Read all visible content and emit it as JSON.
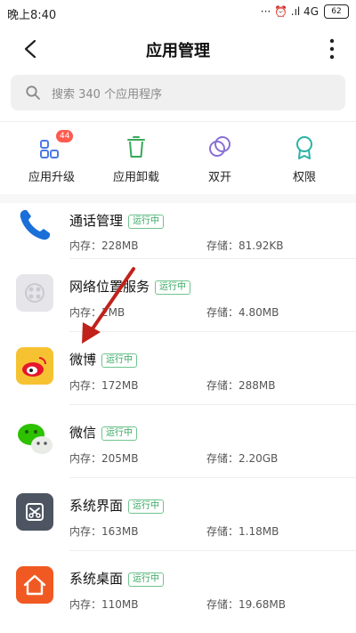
{
  "status_bar": {
    "time": "晚上8:40",
    "indicators": "··· ⏰ .ıl 4G",
    "battery": "62"
  },
  "header": {
    "title": "应用管理"
  },
  "search": {
    "placeholder": "搜索 340 个应用程序"
  },
  "quick_actions": [
    {
      "label": "应用升级",
      "badge": "44",
      "icon": "app-grid-icon"
    },
    {
      "label": "应用卸载",
      "icon": "trash-icon"
    },
    {
      "label": "双开",
      "icon": "dual-circle-icon"
    },
    {
      "label": "权限",
      "icon": "badge-ribbon-icon"
    }
  ],
  "status_tag": "运行中",
  "apps": [
    {
      "name": "通话管理",
      "mem_label": "内存：228MB",
      "sto_label": "存储：81.92KB",
      "icon": "phone-icon",
      "color": "#1a6fd8"
    },
    {
      "name": "网络位置服务",
      "mem_label": "内存：2MB",
      "sto_label": "存储：4.80MB",
      "icon": "network-location-icon",
      "color": "#e6e6ea"
    },
    {
      "name": "微博",
      "mem_label": "内存：172MB",
      "sto_label": "存储：288MB",
      "icon": "weibo-icon",
      "color": "#f6c231"
    },
    {
      "name": "微信",
      "mem_label": "内存：205MB",
      "sto_label": "存储：2.20GB",
      "icon": "wechat-icon",
      "color": "#2dc100"
    },
    {
      "name": "系统界面",
      "mem_label": "内存：163MB",
      "sto_label": "存储：1.18MB",
      "icon": "system-ui-icon",
      "color": "#4c5561"
    },
    {
      "name": "系统桌面",
      "mem_label": "内存：110MB",
      "sto_label": "存储：19.68MB",
      "icon": "home-icon",
      "color": "#f05a22"
    }
  ],
  "annotation_color": "#c0221b"
}
